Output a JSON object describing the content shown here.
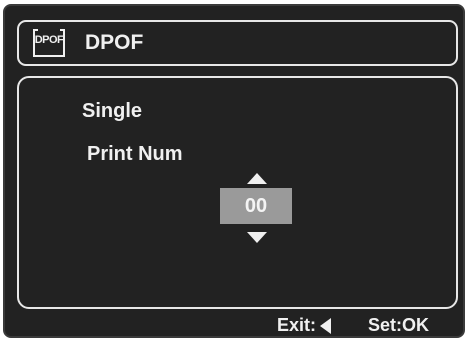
{
  "header": {
    "icon": "dpof-icon",
    "icon_text": "DPOF",
    "title": "DPOF"
  },
  "panel": {
    "mode": "Single",
    "field_label": "Print Num",
    "value": "00"
  },
  "footer": {
    "exit_label": "Exit:",
    "exit_icon": "left-arrow-icon",
    "set_label": "Set:OK"
  },
  "colors": {
    "background": "#222222",
    "text": "#f0f0f0",
    "value_box": "#9a9a9a"
  }
}
